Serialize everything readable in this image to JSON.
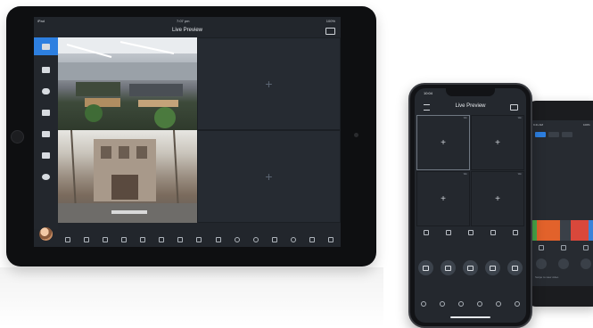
{
  "ipad": {
    "status": {
      "device": "iPad",
      "time": "7:07 pm",
      "battery": "100%"
    },
    "title": "Live Preview",
    "sidebar": {
      "items": [
        {
          "icon": "live-view-icon",
          "active": true
        },
        {
          "icon": "playback-icon"
        },
        {
          "icon": "cloud-icon"
        },
        {
          "icon": "devices-icon"
        },
        {
          "icon": "message-icon"
        },
        {
          "icon": "files-icon"
        },
        {
          "icon": "settings-icon"
        }
      ]
    },
    "empty_cell_glyph": "+",
    "toolbar": [
      "play-icon",
      "image-icon",
      "volume-icon",
      "stream-icon",
      "star-icon",
      "record-icon",
      "snapshot-icon",
      "mic-icon",
      "layout-icon",
      "refresh-icon",
      "ptz-icon",
      "quality-icon",
      "fisheye-icon",
      "alarm-icon",
      "more-icon"
    ]
  },
  "iphone": {
    "status": {
      "time": "10:04"
    },
    "title": "Live Preview",
    "cells": [
      {
        "label": "Win",
        "glyph": "+"
      },
      {
        "label": "Win",
        "glyph": "+"
      },
      {
        "label": "Win",
        "glyph": "+"
      },
      {
        "label": "Win",
        "glyph": "+"
      }
    ],
    "controls": [
      "play-icon",
      "stream-icon",
      "volume-icon",
      "layout-icon",
      "star-icon"
    ],
    "actions": [
      "record-icon",
      "video-icon",
      "snapshot-icon",
      "mic-icon",
      "ptz-icon"
    ],
    "bottom": [
      "fisheye-icon",
      "zoom-icon",
      "light-icon",
      "alarm-icon",
      "more-icon",
      "collapse-icon"
    ]
  },
  "android": {
    "status": {
      "time": "9:41 AM",
      "battery": "100%"
    },
    "timeline_colors": [
      "#48a84a",
      "#e2622b",
      "#d9483b",
      "#3b82d9"
    ],
    "hint": "Swipe to view video"
  }
}
